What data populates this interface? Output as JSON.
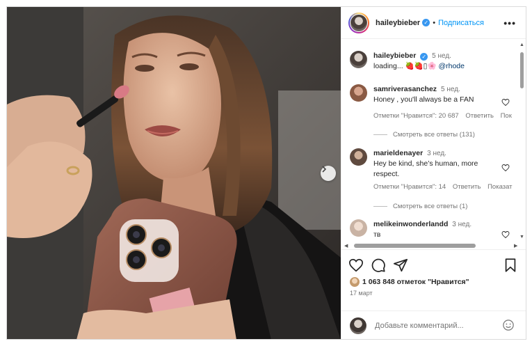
{
  "post": {
    "username": "haileybieber",
    "follow_label": "Подписаться",
    "separator": "•",
    "more_label": "•••"
  },
  "caption": {
    "username": "haileybieber",
    "time": "5 нед.",
    "text": "loading... 🍓🍓▯🌸",
    "mention": "@rhode"
  },
  "comments": [
    {
      "username": "samriverasanchez",
      "time": "5 нед.",
      "text": "Honey , you'll always be a FAN",
      "likes": "Отметки \"Нравится\": 20 687",
      "reply": "Ответить",
      "extra": "Пок",
      "view_replies": "Смотреть все ответы (131)"
    },
    {
      "username": "marieldenayer",
      "time": "3 нед.",
      "text": "Hey be kind, she’s human, more",
      "text2": "respect.",
      "likes": "Отметки \"Нравится\": 14",
      "reply": "Ответить",
      "extra": "Показат",
      "view_replies": "Смотреть все ответы (1)"
    },
    {
      "username": "melikeinwonderlandd",
      "time": "3 нед.",
      "text": "тв"
    }
  ],
  "stats": {
    "likes_text": "1 063 848 отметок \"Нравится\"",
    "date": "17 март"
  },
  "add_comment": {
    "placeholder": "Добавьте комментарий..."
  },
  "icons": {
    "like": "heart-icon",
    "comment": "comment-icon",
    "share": "share-icon",
    "save": "bookmark-icon",
    "emoji": "emoji-icon",
    "next": "chevron-right-icon"
  },
  "colors": {
    "link": "#0095f6",
    "verified": "#3897f0",
    "muted": "#737373"
  }
}
